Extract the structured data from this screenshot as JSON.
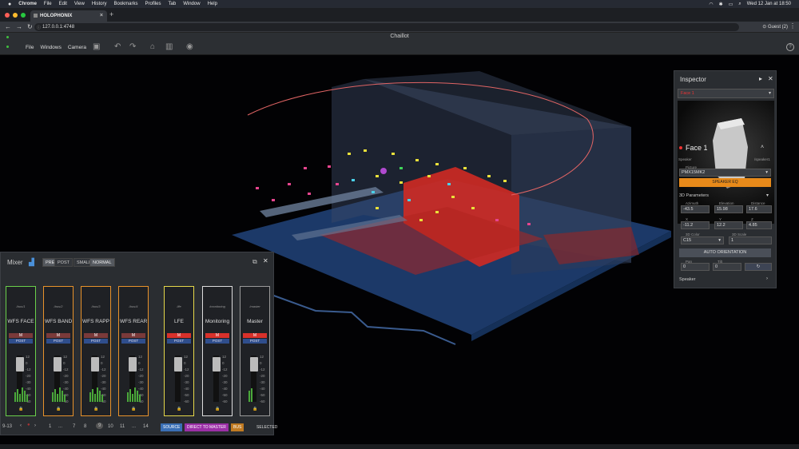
{
  "menubar": {
    "apple": "",
    "app": "Chrome",
    "items": [
      "File",
      "Edit",
      "View",
      "History",
      "Bookmarks",
      "Profiles",
      "Tab",
      "Window",
      "Help"
    ],
    "clock": "Wed 12 Jan at 18:50"
  },
  "browser": {
    "tab_title": "HOLOPHONIX",
    "url": "127.0.0.1:4748",
    "user": "Guest (2)"
  },
  "app": {
    "title": "Chaillot",
    "menu": [
      "File",
      "Windows",
      "Camera"
    ]
  },
  "inspector": {
    "title": "Inspector",
    "selected": "Face 1",
    "name": "Face 1",
    "type_label": "Speaker",
    "type_value": "/speaker1",
    "picture_label": "Picture",
    "picture_value": "PMX15MK2",
    "eq_button": "SPEAKER EQ",
    "section_3d": "3D Parameters",
    "azimuth": {
      "label": "Azimuth",
      "value": "-43.5"
    },
    "elevation": {
      "label": "Elevation",
      "value": "15.98"
    },
    "distance": {
      "label": "Distance",
      "value": "17.6"
    },
    "x": {
      "label": "X",
      "value": "-11.2"
    },
    "y": {
      "label": "Y",
      "value": "12.2"
    },
    "z": {
      "label": "Z",
      "value": "4.85"
    },
    "color_label": "3D Color",
    "color_value": "C15",
    "scale_label": "3D Scale",
    "scale_value": "1",
    "auto_button": "AUTO ORIENTATION",
    "pan": {
      "label": "Pan",
      "value": "0"
    },
    "tilt": {
      "label": "Tilt",
      "value": "0"
    },
    "footer": "Speaker"
  },
  "mixer": {
    "title": "Mixer",
    "modes": [
      "PRE",
      "POST",
      "SMALL",
      "NORMAL"
    ],
    "strips": [
      {
        "bus": "/bus/1",
        "name": "WFS FACE",
        "border": "#6ad04a"
      },
      {
        "bus": "/bus/2",
        "name": "WFS BAND",
        "border": "#e8922a"
      },
      {
        "bus": "/bus/3",
        "name": "WFS RAPPE",
        "border": "#e8922a"
      },
      {
        "bus": "/bus/4",
        "name": "WFS REAR",
        "border": "#e8922a"
      },
      {
        "bus": "/lfe",
        "name": "LFE",
        "border": "#e6d84a"
      },
      {
        "bus": "/monitoring",
        "name": "Monitoring",
        "border": "#dddddd"
      },
      {
        "bus": "/master",
        "name": "Master",
        "border": "#9a9a9a"
      }
    ],
    "mute": "M",
    "post": "POST",
    "scale": [
      "12",
      "0",
      "-12",
      "-20",
      "-30",
      "-40",
      "-50",
      "-60"
    ],
    "footer": {
      "range": "9-13",
      "pages": [
        "1",
        "...",
        "7",
        "8",
        "9",
        "10",
        "11",
        "...",
        "14"
      ],
      "source": "SOURCE",
      "direct": "DIRECT TO MASTER",
      "bus": "BUS",
      "selected": "SELECTED"
    }
  },
  "colors": {
    "accent": "#e88a1a",
    "post": "#2f4e8c",
    "red": "#d8312b",
    "blue": "#3a6fb5"
  }
}
